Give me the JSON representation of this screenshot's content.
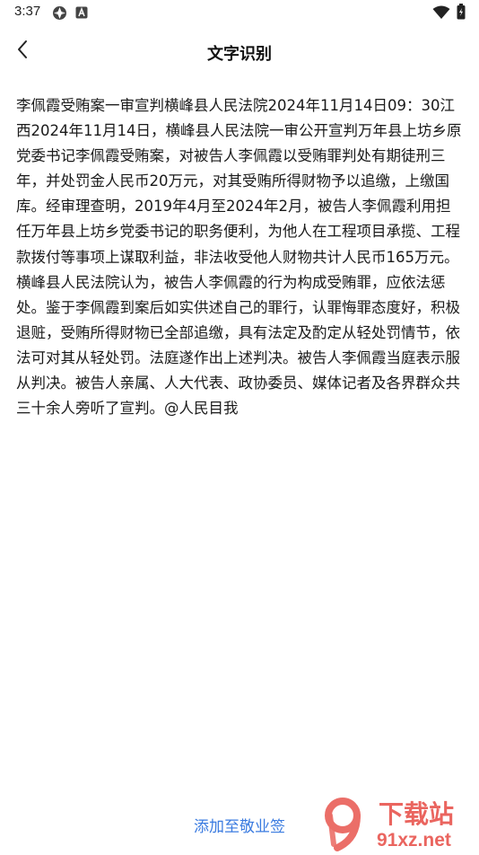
{
  "status_bar": {
    "time": "3:37"
  },
  "header": {
    "title": "文字识别"
  },
  "content": {
    "text": "李佩霞受贿案一审宣判横峰县人民法院2024年11月14日09：30江西2024年11月14日，横峰县人民法院一审公开宣判万年县上坊乡原党委书记李佩霞受贿案，对被告人李佩霞以受贿罪判处有期徒刑三年，并处罚金人民币20万元，对其受贿所得财物予以追缴，上缴国库。经审理查明，2019年4月至2024年2月，被告人李佩霞利用担任万年县上坊乡党委书记的职务便利，为他人在工程项目承揽、工程款拨付等事项上谋取利益，非法收受他人财物共计人民币165万元。横峰县人民法院认为，被告人李佩霞的行为构成受贿罪，应依法惩处。鉴于李佩霞到案后如实供述自己的罪行，认罪悔罪态度好，积极退赃，受贿所得财物已全部追缴，具有法定及酌定从轻处罚情节，依法可对其从轻处罚。法庭遂作出上述判决。被告人李佩霞当庭表示服从判决。被告人亲属、人大代表、政协委员、媒体记者及各界群众共三十余人旁听了宣判。@人民目我"
  },
  "footer": {
    "add_link": "添加至敬业签"
  },
  "watermark": {
    "top_text": "下载站",
    "bottom_text": "91xz.net"
  },
  "colors": {
    "link": "#3a7be0",
    "watermark": "#e8554e"
  }
}
